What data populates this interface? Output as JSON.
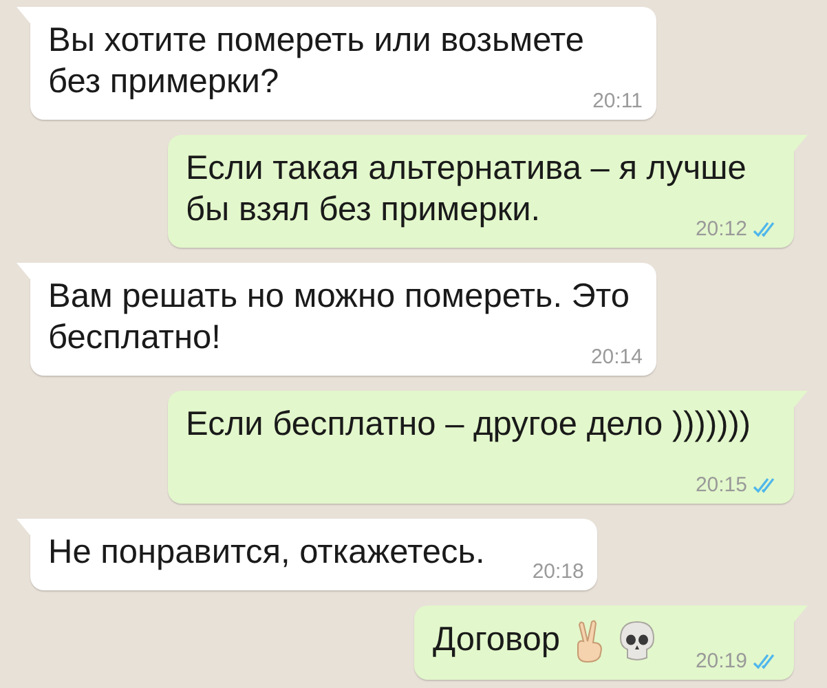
{
  "messages": [
    {
      "outgoing": false,
      "kind": "text",
      "text": "Вы хотите помереть или возьмете без примерки?",
      "time": "20:11"
    },
    {
      "outgoing": true,
      "kind": "text",
      "text": "Если такая альтернатива – я лучше бы взял без примерки.",
      "time": "20:12",
      "read": true
    },
    {
      "outgoing": false,
      "kind": "text",
      "text": "Вам решать но можно помереть. Это бесплатно!",
      "time": "20:14"
    },
    {
      "outgoing": true,
      "kind": "text",
      "text": "Если бесплатно – другое дело )))))))",
      "time": "20:15",
      "read": true
    },
    {
      "outgoing": false,
      "kind": "text",
      "text": "Не понравится, откажетесь.",
      "time": "20:18"
    },
    {
      "outgoing": true,
      "kind": "emoji",
      "text": "Договор",
      "time": "20:19",
      "read": true
    }
  ]
}
